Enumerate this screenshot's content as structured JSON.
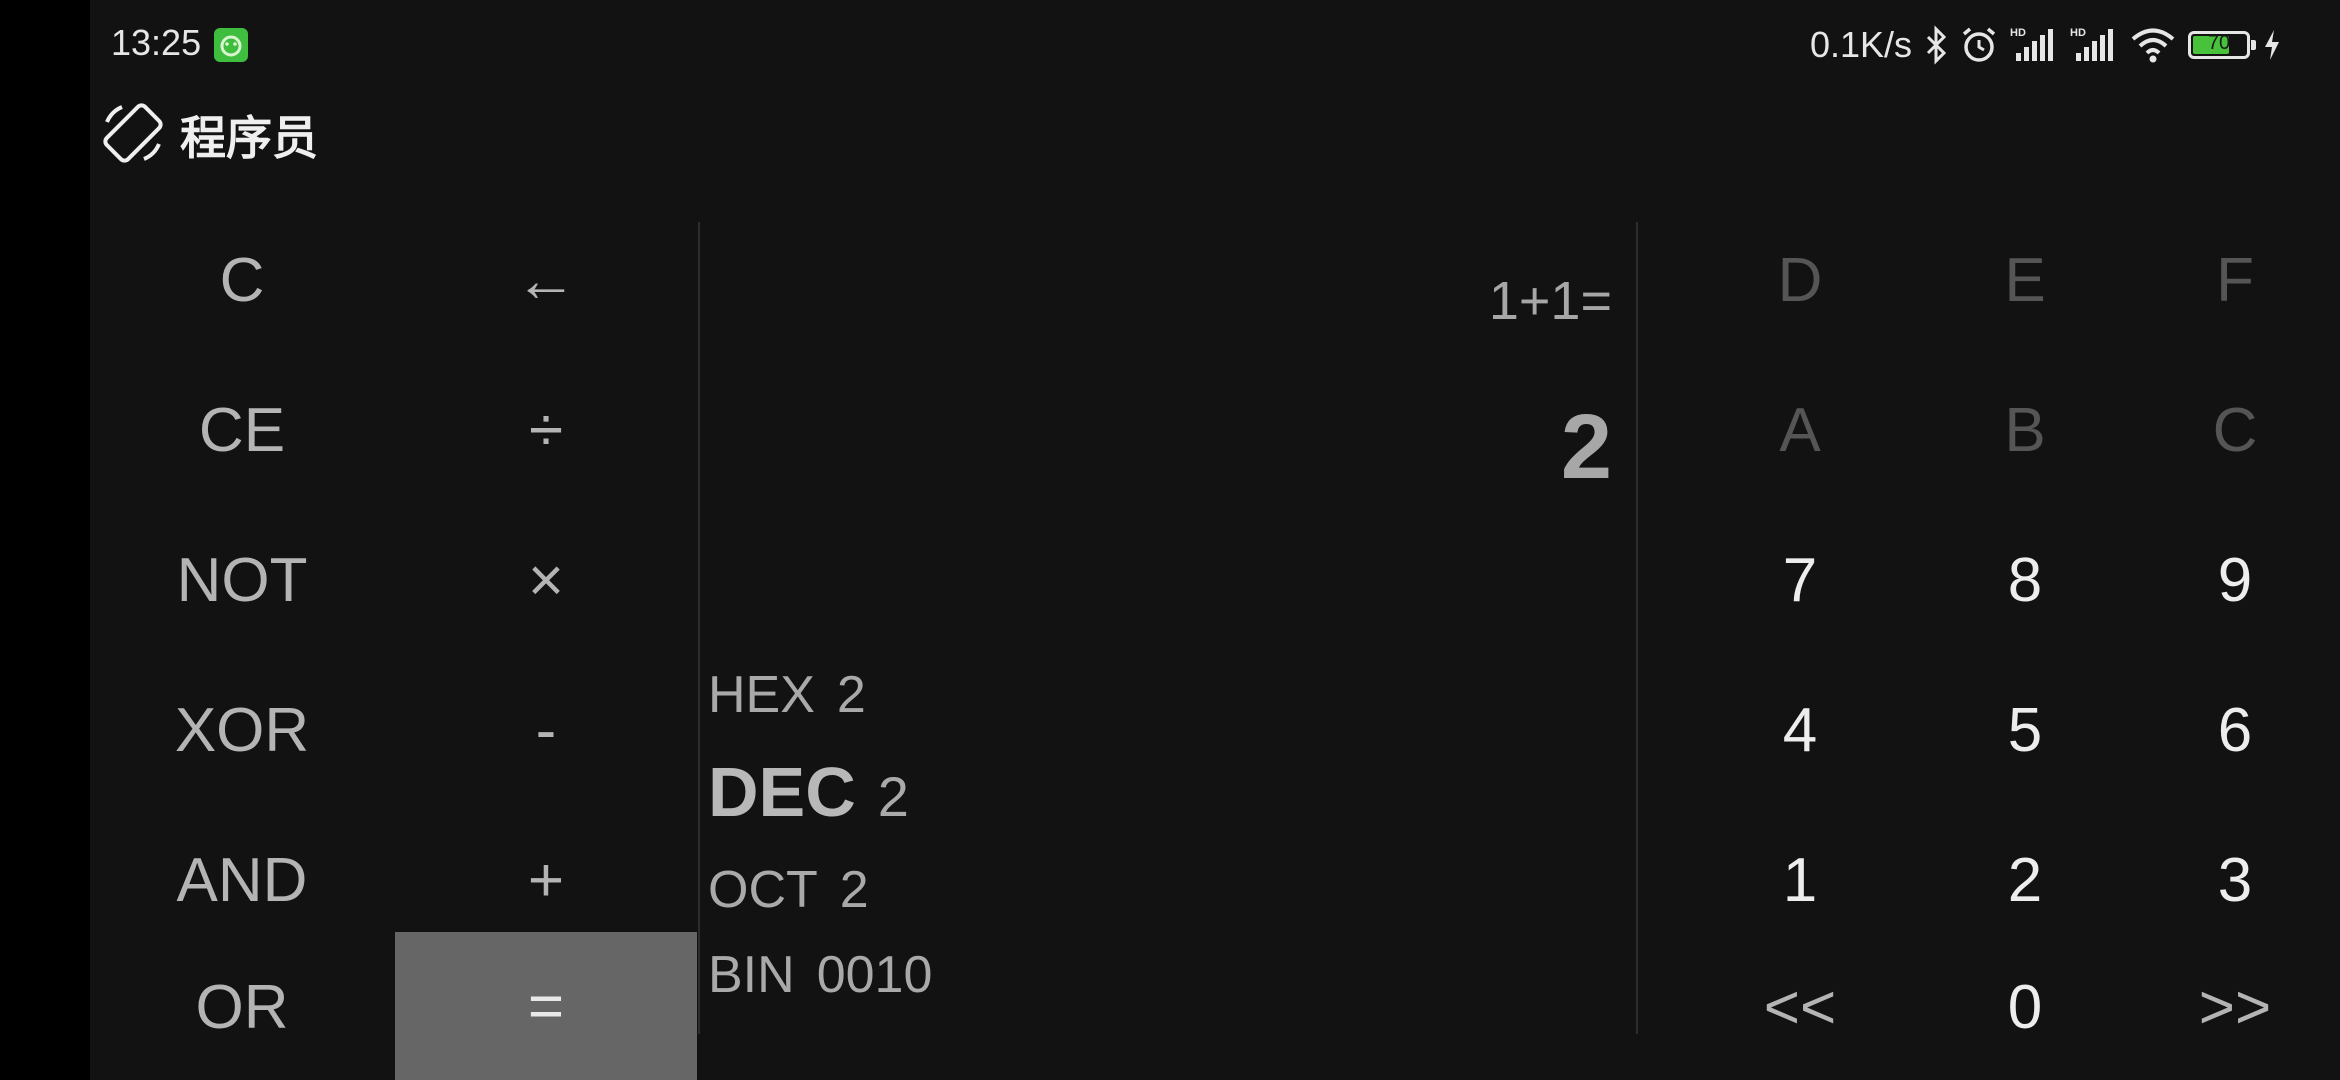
{
  "status_bar": {
    "time": "13:25",
    "net_speed": "0.1K/s",
    "battery_level": "70",
    "battery_fraction": 0.7,
    "icons": [
      "app-notification-icon",
      "bluetooth-icon",
      "alarm-icon",
      "signal-hd-icon",
      "signal-hd-icon",
      "wifi-icon",
      "battery-icon",
      "charging-icon"
    ]
  },
  "header": {
    "mode_title": "程序员",
    "rotate_icon": "screen-rotate-icon"
  },
  "display": {
    "expression": "1+1=",
    "result": "2"
  },
  "bases": [
    {
      "label": "HEX",
      "value": "2",
      "active": false
    },
    {
      "label": "DEC",
      "value": "2",
      "active": true
    },
    {
      "label": "OCT",
      "value": "2",
      "active": false
    },
    {
      "label": "BIN",
      "value": "0010",
      "active": false
    }
  ],
  "left_keys": {
    "col1": [
      "C",
      "CE",
      "NOT",
      "XOR",
      "AND",
      "OR"
    ],
    "col2": [
      "←",
      "÷",
      "×",
      "-",
      "+",
      "="
    ]
  },
  "right_keys": {
    "rows": [
      [
        "D",
        "E",
        "F"
      ],
      [
        "A",
        "B",
        "C"
      ],
      [
        "7",
        "8",
        "9"
      ],
      [
        "4",
        "5",
        "6"
      ],
      [
        "1",
        "2",
        "3"
      ],
      [
        "<<",
        "0",
        ">>"
      ]
    ]
  },
  "colors": {
    "background": "#121212",
    "equals_key": "#666666",
    "disabled_key": "#555555",
    "battery_fill": "#48c23a",
    "app_badge": "#3ebd3e"
  }
}
